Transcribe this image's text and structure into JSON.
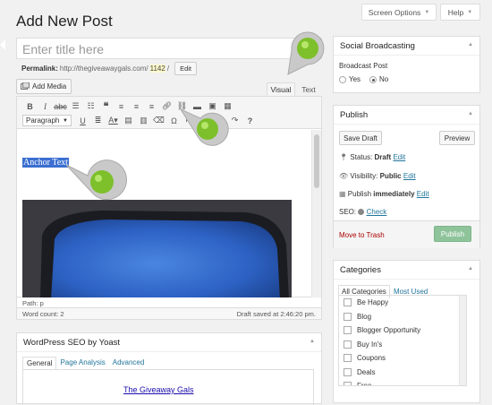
{
  "page_title": "Add New Post",
  "screen_options_label": "Screen Options",
  "help_label": "Help",
  "title_placeholder": "Enter title here",
  "permalink": {
    "label": "Permalink:",
    "base": "http://thegiveawaygals.com/",
    "slug": "1142",
    "trail": "/",
    "edit_label": "Edit"
  },
  "add_media_label": "Add Media",
  "editor_tabs": {
    "visual": "Visual",
    "text": "Text"
  },
  "toolbar": {
    "format_value": "Paragraph"
  },
  "content": {
    "anchor_text": "Anchor Text"
  },
  "footer": {
    "path": "Path: p",
    "word_count": "Word count: 2",
    "draft_saved": "Draft saved at 2:46:20 pm."
  },
  "social": {
    "title": "Social Broadcasting",
    "label": "Broadcast Post",
    "yes": "Yes",
    "no": "No",
    "selected": "No"
  },
  "publish": {
    "title": "Publish",
    "save_draft": "Save Draft",
    "preview": "Preview",
    "status_label": "Status:",
    "status_value": "Draft",
    "visibility_label": "Visibility:",
    "visibility_value": "Public",
    "schedule_label": "Publish",
    "schedule_value": "immediately",
    "edit_link": "Edit",
    "seo_label": "SEO:",
    "seo_check": "Check",
    "trash": "Move to Trash",
    "publish_button": "Publish"
  },
  "categories": {
    "title": "Categories",
    "tab_all": "All Categories",
    "tab_used": "Most Used",
    "items": [
      "Be Happy",
      "Blog",
      "Blogger Opportunity",
      "Buy In's",
      "Coupons",
      "Deals",
      "Free"
    ]
  },
  "yoast": {
    "title": "WordPress SEO by Yoast",
    "tabs": [
      "General",
      "Page Analysis",
      "Advanced"
    ],
    "snippet_title": "The Giveaway Gals"
  },
  "colors": {
    "accent": "#21759b",
    "pin_green": "#7dc02b",
    "selection": "#3b6fd1",
    "publish_disabled": "#8fc49b"
  }
}
